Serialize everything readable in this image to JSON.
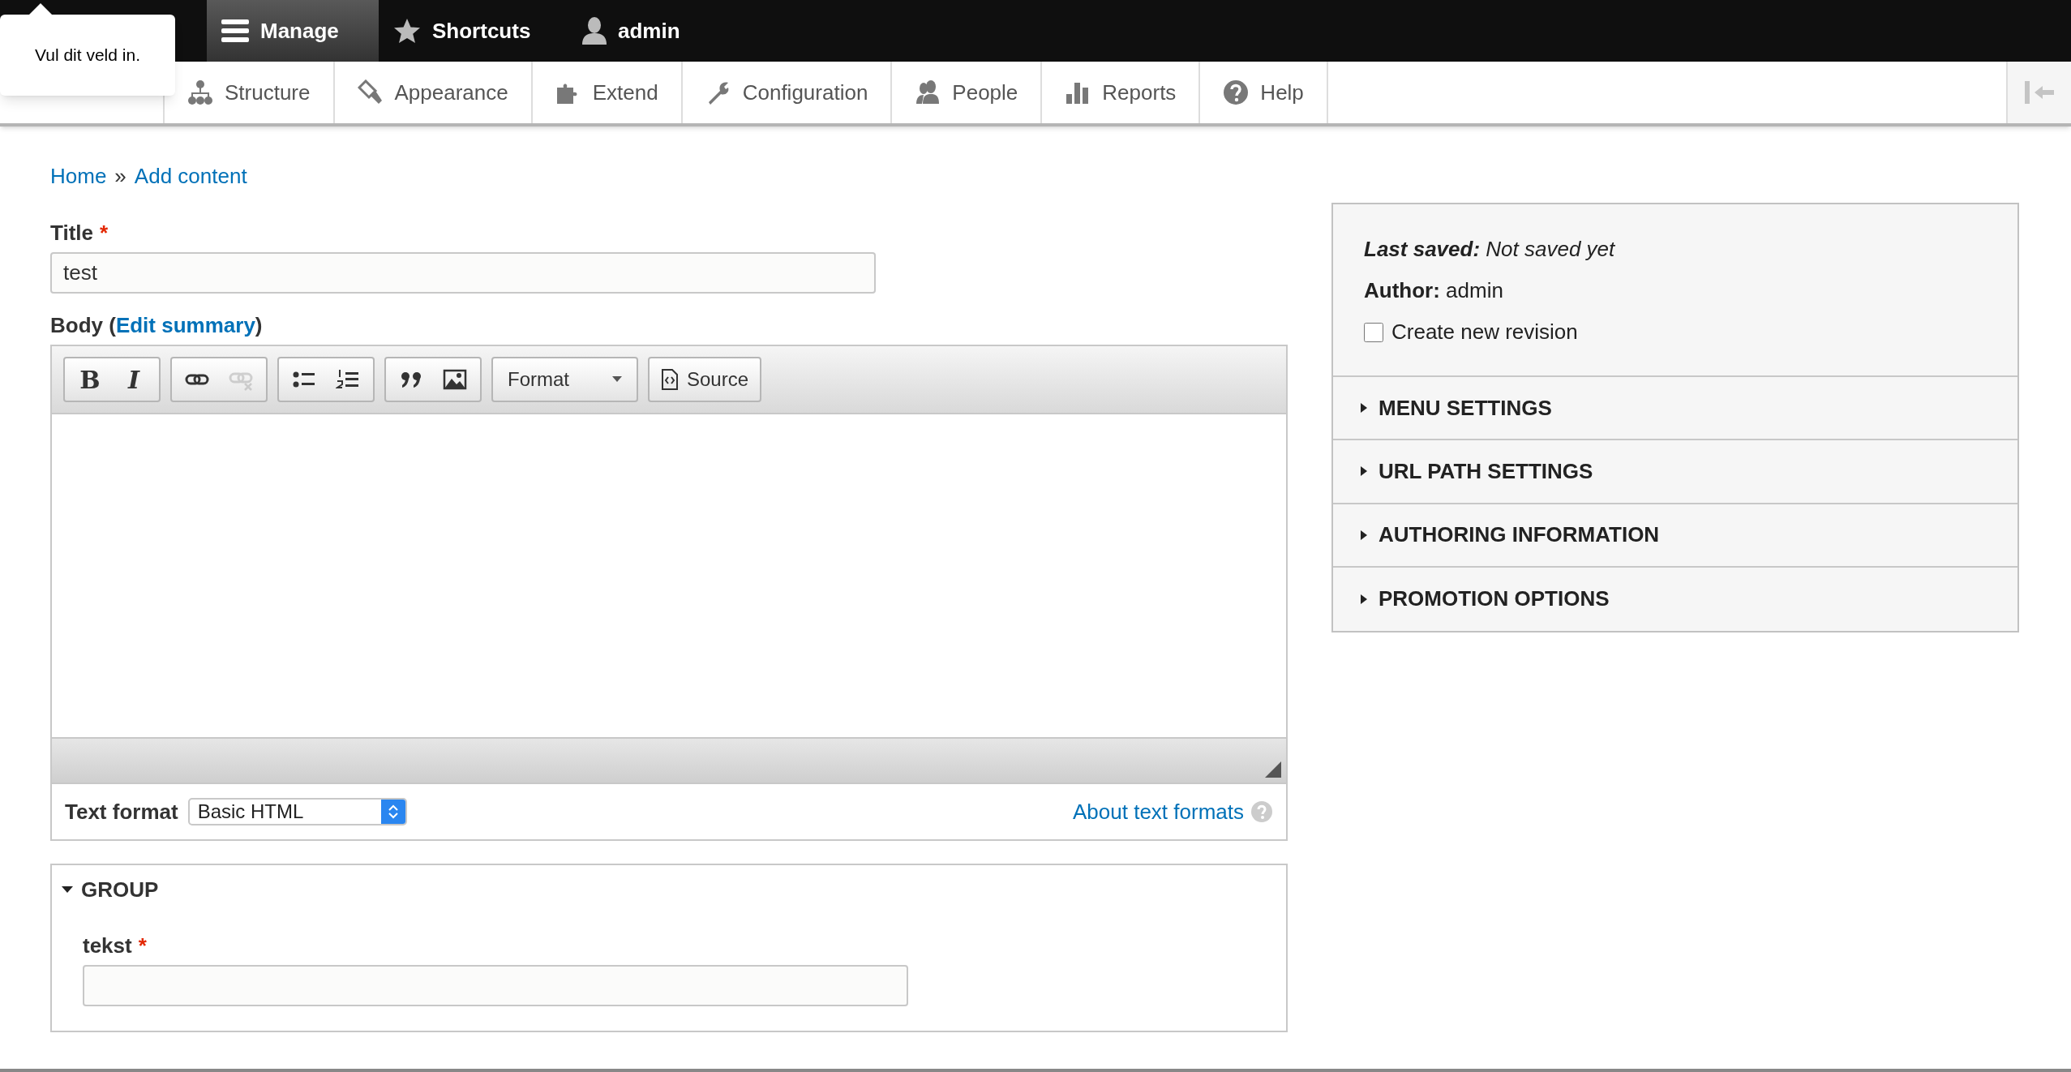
{
  "toolbar": {
    "items": [
      {
        "label": "Manage",
        "kind": "menu",
        "selected": true
      },
      {
        "label": "Shortcuts",
        "kind": "star",
        "selected": false
      },
      {
        "label": "admin",
        "kind": "user",
        "selected": false
      }
    ]
  },
  "tooltip": {
    "text": "Vul dit veld in."
  },
  "tray": {
    "items": [
      {
        "label": "Structure",
        "kind": "structure"
      },
      {
        "label": "Appearance",
        "kind": "appearance"
      },
      {
        "label": "Extend",
        "kind": "extend"
      },
      {
        "label": "Configuration",
        "kind": "configuration"
      },
      {
        "label": "People",
        "kind": "people"
      },
      {
        "label": "Reports",
        "kind": "reports"
      },
      {
        "label": "Help",
        "kind": "help"
      }
    ]
  },
  "breadcrumb": {
    "items": [
      {
        "label": "Home"
      },
      {
        "label": "Add content"
      }
    ],
    "separator": "»"
  },
  "title_field": {
    "label": "Title",
    "required_mark": "*",
    "value": "test"
  },
  "body": {
    "label": "Body (",
    "link": "Edit summary",
    "label_end": ")",
    "editor_toolbar": [
      {
        "buttons": [
          {
            "kind": "bold",
            "label": "B",
            "disabled": false
          },
          {
            "kind": "italic",
            "label": "I",
            "disabled": false
          }
        ]
      },
      {
        "buttons": [
          {
            "kind": "link",
            "disabled": false
          },
          {
            "kind": "unlink",
            "disabled": true
          }
        ]
      },
      {
        "buttons": [
          {
            "kind": "bullets",
            "disabled": false
          },
          {
            "kind": "numbers",
            "disabled": false
          }
        ]
      },
      {
        "buttons": [
          {
            "kind": "quote",
            "disabled": false
          },
          {
            "kind": "image",
            "disabled": false
          }
        ]
      }
    ],
    "format_dropdown": "Format",
    "source_button": "Source"
  },
  "text_format": {
    "label": "Text format",
    "value": "Basic HTML",
    "help_link": "About text formats"
  },
  "group": {
    "title": "GROUP",
    "expanded": true,
    "field": {
      "label": "tekst",
      "required_mark": "*"
    }
  },
  "sidebar": {
    "last_saved": "**Last saved:** Not saved yet",
    "author": "**Author:** admin",
    "revision": {
      "label": "Create new revision",
      "checked": false
    },
    "sections": [
      {
        "title": "MENU SETTINGS",
        "expanded": false
      },
      {
        "title": "URL PATH SETTINGS",
        "expanded": false
      },
      {
        "title": "AUTHORING INFORMATION",
        "expanded": false
      },
      {
        "title": "PROMOTION OPTIONS",
        "expanded": false
      }
    ]
  }
}
